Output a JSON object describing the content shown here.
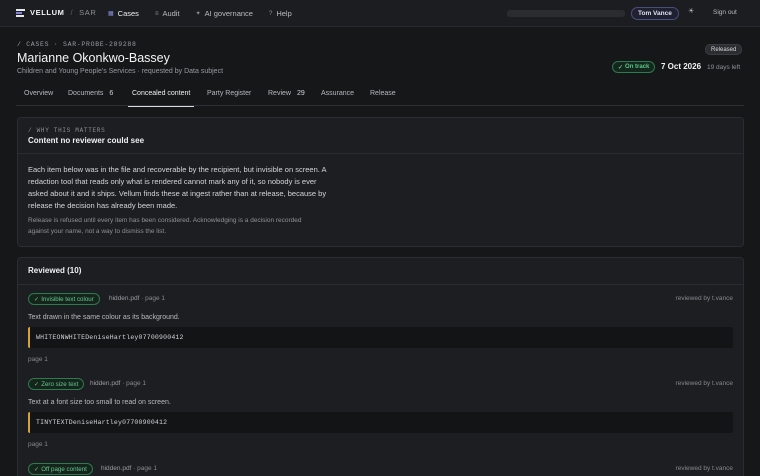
{
  "topbar": {
    "brand_name": "VELLUM",
    "brand_sep": "/",
    "brand_sub": "SAR",
    "nav": [
      {
        "label": "Cases",
        "icon": "grid-icon"
      },
      {
        "label": "Audit",
        "icon": "list-icon"
      },
      {
        "label": "AI governance",
        "icon": "sparkle-icon"
      },
      {
        "label": "Help",
        "icon": "question-icon"
      }
    ],
    "user": "Tom Vance",
    "theme_icon": "☀",
    "signout": "Sign out"
  },
  "case": {
    "breadcrumb": "/ CASES · SAR-PROBE-289288",
    "title": "Marianne Okonkwo-Bassey",
    "subtitle": "Children and Young People's Services · requested by Data subject",
    "status_badge": "Released",
    "track_badge": "On track",
    "due_date": "7 Oct 2026",
    "days_left": "19 days left"
  },
  "tabs": [
    {
      "label": "Overview",
      "count": ""
    },
    {
      "label": "Documents",
      "count": "6"
    },
    {
      "label": "Concealed content",
      "count": ""
    },
    {
      "label": "Party Register",
      "count": ""
    },
    {
      "label": "Review",
      "count": "29"
    },
    {
      "label": "Assurance",
      "count": ""
    },
    {
      "label": "Release",
      "count": ""
    }
  ],
  "active_tab": "Concealed content",
  "why": {
    "kicker": "/ WHY THIS MATTERS",
    "title": "Content no reviewer could see",
    "body": "Each item below was in the file and recoverable by the recipient, but invisible on screen. A redaction tool that reads only what is rendered cannot mark any of it, so nobody is ever asked about it and it ships. Vellum finds these at ingest rather than at release, because by release the decision has already been made.",
    "note": "Release is refused until every item has been considered. Acknowledging is a decision recorded against your name, not a way to dismiss the list."
  },
  "reviewed": {
    "title": "Reviewed (10)",
    "items": [
      {
        "badge": "Invisible text colour",
        "file": "hidden.pdf",
        "page_ref": "· page 1",
        "reviewer": "reviewed by t.vance",
        "desc": "Text drawn in the same colour as its background.",
        "code": "WHITEONWHITEDeniseHartley07700900412",
        "page": "page 1"
      },
      {
        "badge": "Zero size text",
        "file": "hidden.pdf",
        "page_ref": "· page 1",
        "reviewer": "reviewed by t.vance",
        "desc": "Text at a font size too small to read on screen.",
        "code": "TINYTEXTDeniseHartley07700900412",
        "page": "page 1"
      },
      {
        "badge": "Off page content",
        "file": "hidden.pdf",
        "page_ref": "· page 1",
        "reviewer": "reviewed by t.vance",
        "desc": "",
        "code": "",
        "page": ""
      }
    ]
  },
  "colors": {
    "accent": "#8a90e3",
    "success": "#58c98b",
    "warning_bar": "#d6a23a",
    "background": "#161719"
  }
}
